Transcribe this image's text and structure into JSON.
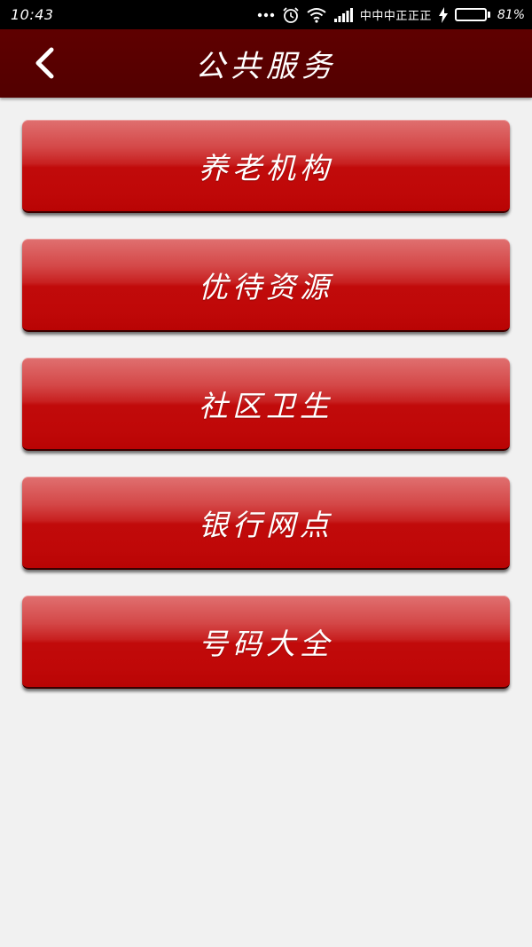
{
  "status_bar": {
    "time": "10:43",
    "carrier": "中中中正正正",
    "battery_percent": "81%",
    "battery_level": 0.81,
    "icons": [
      "more-dots-icon",
      "alarm-icon",
      "wifi-icon",
      "signal-icon",
      "charging-icon",
      "battery-icon"
    ],
    "battery_color": "#57e04a"
  },
  "header": {
    "title": "公共服务",
    "back_icon": "chevron-left-icon",
    "background": "#5a0000"
  },
  "menu": {
    "items": [
      {
        "label": "养老机构"
      },
      {
        "label": "优待资源"
      },
      {
        "label": "社区卫生"
      },
      {
        "label": "银行网点"
      },
      {
        "label": "号码大全"
      }
    ],
    "button_color": "#c10a0a"
  }
}
